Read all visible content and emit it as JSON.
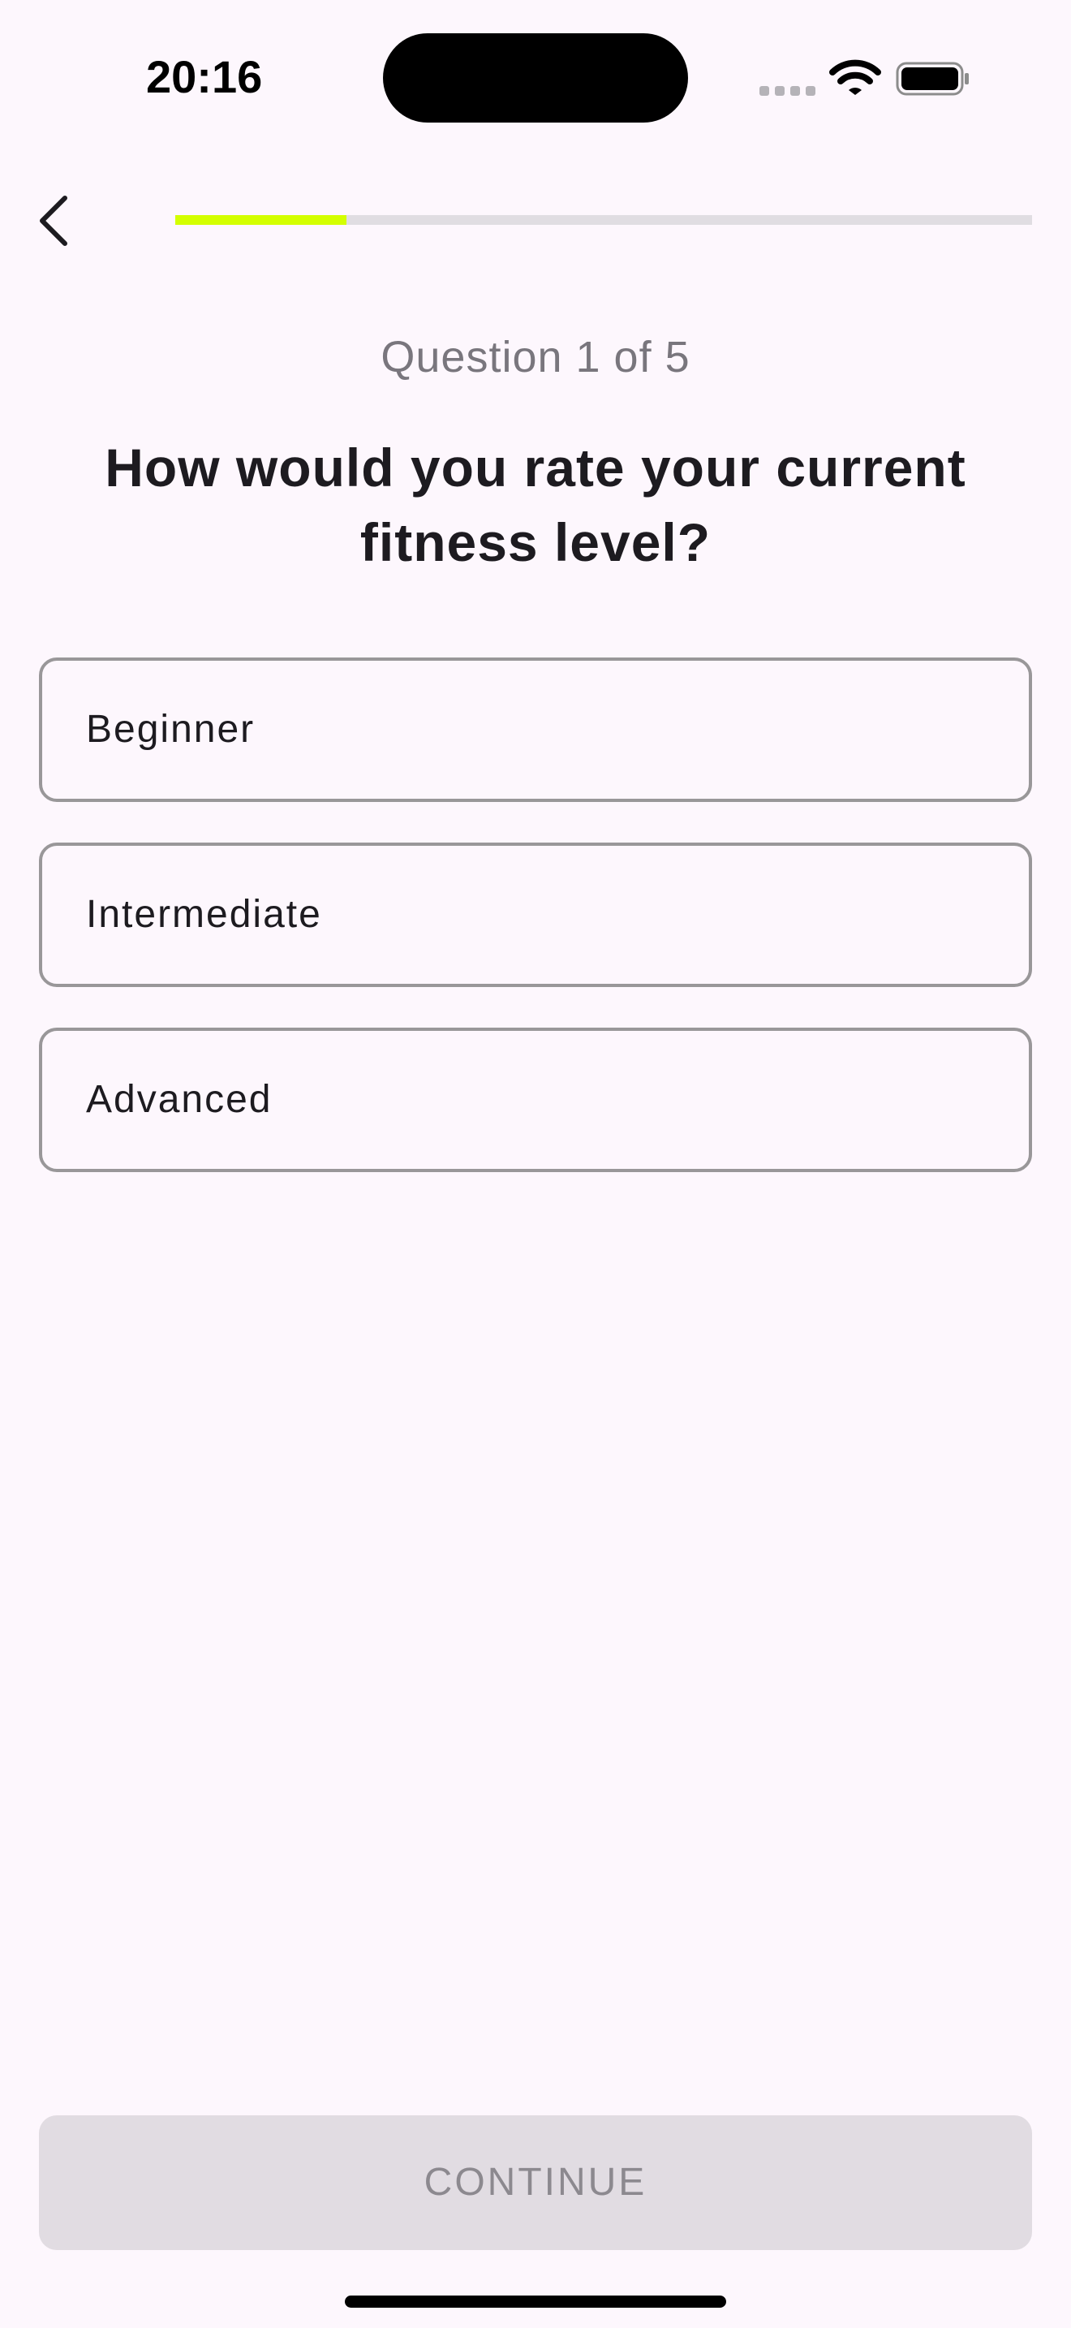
{
  "status_bar": {
    "time": "20:16",
    "icons": [
      "signal-dots-icon",
      "wifi-icon",
      "battery-icon"
    ]
  },
  "header": {
    "back_icon": "chevron-left-icon",
    "progress": {
      "current": 1,
      "total": 5,
      "fraction": 0.2,
      "fill_color": "#d4ff00",
      "track_color": "#e0dde2"
    }
  },
  "question": {
    "counter": "Question 1 of 5",
    "title": "How would you rate your current fitness level?"
  },
  "options": [
    {
      "label": "Beginner"
    },
    {
      "label": "Intermediate"
    },
    {
      "label": "Advanced"
    }
  ],
  "footer": {
    "continue_label": "CONTINUE",
    "continue_enabled": false
  },
  "colors": {
    "background": "#fdf7fd",
    "accent": "#d4ff00",
    "option_border": "#999799",
    "disabled_button": "#e1dce2",
    "disabled_text": "#8c898f"
  }
}
